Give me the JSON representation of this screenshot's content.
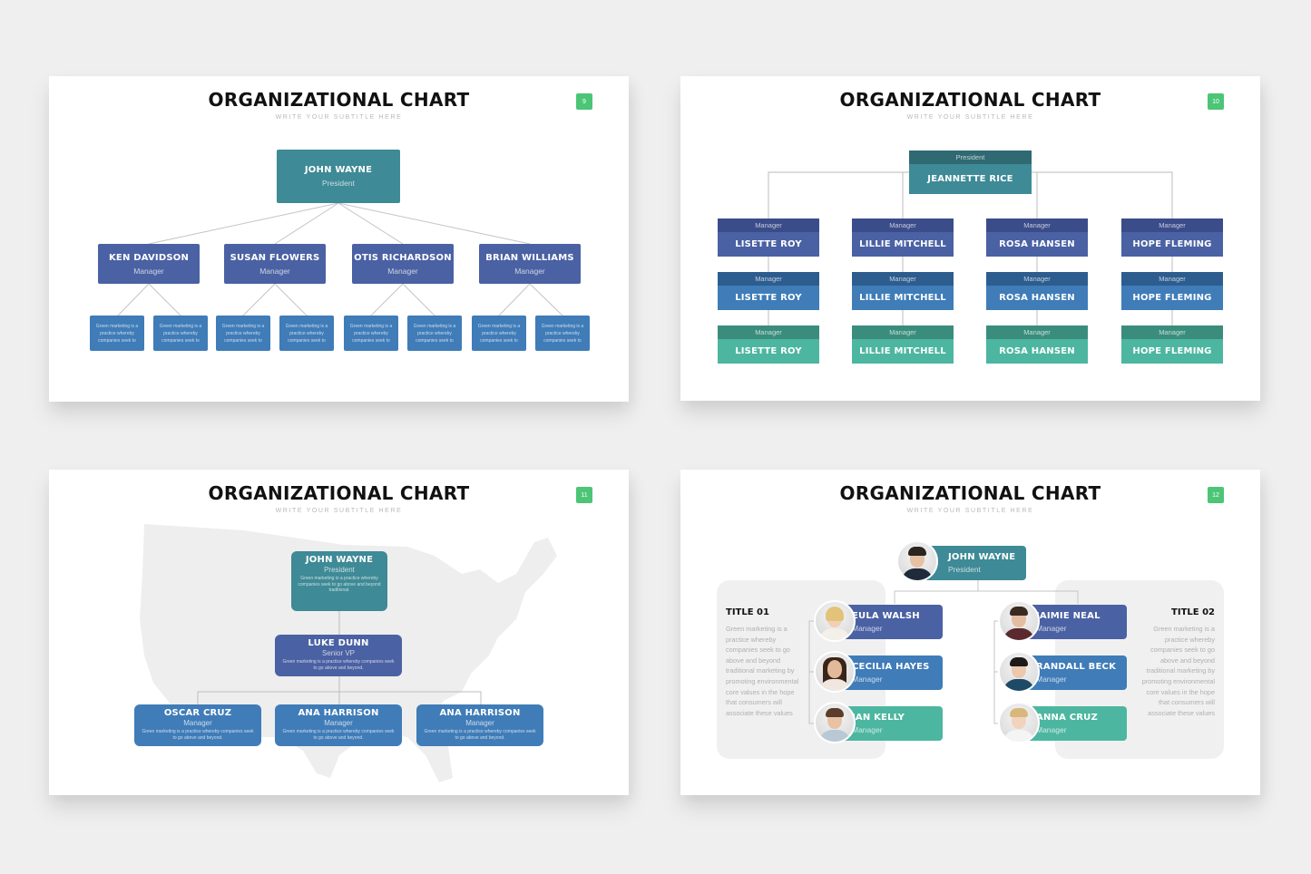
{
  "colors": {
    "teal": "#3e8a96",
    "indigo": "#4a61a3",
    "blue": "#3f7cb8",
    "green": "#4db6a0",
    "badge": "#4cc577"
  },
  "slides": [
    {
      "title": "ORGANIZATIONAL CHART",
      "subtitle": "WRITE YOUR SUBTITLE HERE",
      "page": "9",
      "president": {
        "name": "JOHN WAYNE",
        "role": "President"
      },
      "managers": [
        {
          "name": "KEN DAVIDSON",
          "role": "Manager"
        },
        {
          "name": "SUSAN FLOWERS",
          "role": "Manager"
        },
        {
          "name": "OTIS RICHARDSON",
          "role": "Manager"
        },
        {
          "name": "BRIAN WILLIAMS",
          "role": "Manager"
        }
      ],
      "leaf_text": "Green marketing is a practice whereby companies seek to"
    },
    {
      "title": "ORGANIZATIONAL CHART",
      "subtitle": "WRITE YOUR SUBTITLE HERE",
      "page": "10",
      "president": {
        "name": "JEANNETTE RICE",
        "role": "President"
      },
      "columns": [
        {
          "name": "LISETTE ROY",
          "role": "Manager"
        },
        {
          "name": "LILLIE MITCHELL",
          "role": "Manager"
        },
        {
          "name": "ROSA HANSEN",
          "role": "Manager"
        },
        {
          "name": "HOPE FLEMING",
          "role": "Manager"
        }
      ]
    },
    {
      "title": "ORGANIZATIONAL CHART",
      "subtitle": "WRITE YOUR SUBTITLE HERE",
      "page": "11",
      "president": {
        "name": "JOHN WAYNE",
        "role": "President",
        "desc": "Green marketing is a practice whereby companies seek to go above and beyond traditional."
      },
      "vp": {
        "name": "LUKE DUNN",
        "role": "Senior VP",
        "desc": "Green marketing is a practice whereby companies seek to go above and beyond."
      },
      "managers": [
        {
          "name": "OSCAR CRUZ",
          "role": "Manager",
          "desc": "Green marketing is a practice whereby companies seek to go above and beyond."
        },
        {
          "name": "ANA HARRISON",
          "role": "Manager",
          "desc": "Green marketing is a practice whereby companies seek to go above and beyond."
        },
        {
          "name": "ANA HARRISON",
          "role": "Manager",
          "desc": "Green marketing is a practice whereby companies seek to go above and beyond."
        }
      ]
    },
    {
      "title": "ORGANIZATIONAL CHART",
      "subtitle": "WRITE YOUR SUBTITLE HERE",
      "page": "12",
      "president": {
        "name": "JOHN WAYNE",
        "role": "President"
      },
      "left_panel": {
        "title": "TITLE 01",
        "text": "Green marketing is a practice whereby companies seek to go above and beyond traditional marketing by promoting environmental core values in the hope that consumers will associate these values"
      },
      "right_panel": {
        "title": "TITLE 02",
        "text": "Green marketing is a practice whereby companies seek to go above and beyond traditional marketing by promoting environmental core values in the hope that consumers will associate these values"
      },
      "left_team": [
        {
          "name": "EULA WALSH",
          "role": "Manager"
        },
        {
          "name": "CECILIA HAYES",
          "role": "Manager"
        },
        {
          "name": "JAN KELLY",
          "role": "Manager"
        }
      ],
      "right_team": [
        {
          "name": "JAIMIE NEAL",
          "role": "Manager"
        },
        {
          "name": "RANDALL BECK",
          "role": "Manager"
        },
        {
          "name": "ANNA CRUZ",
          "role": "Manager"
        }
      ]
    }
  ]
}
